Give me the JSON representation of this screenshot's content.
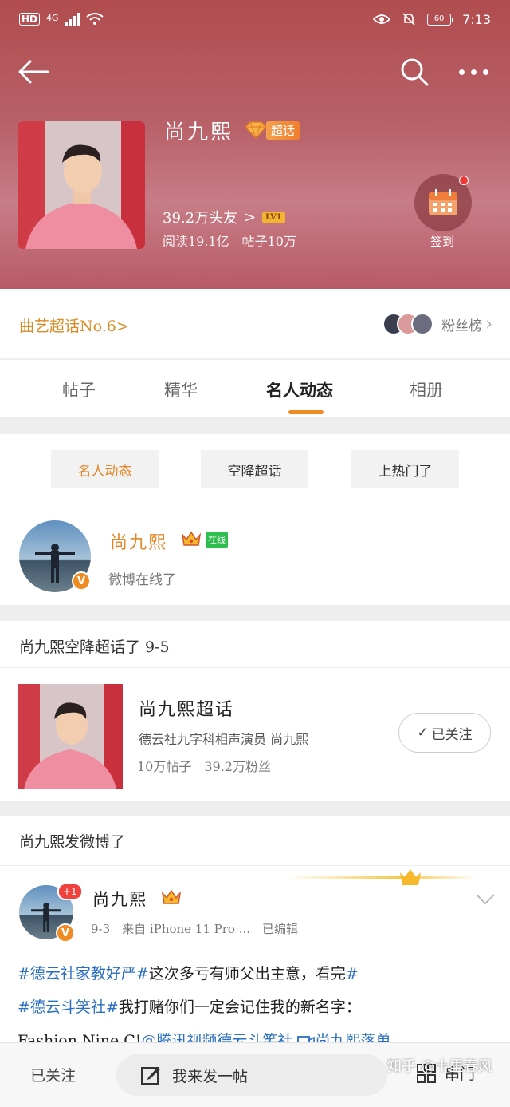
{
  "status_bar": {
    "hd": "HD",
    "network": "4G",
    "battery": "60",
    "time": "7:13"
  },
  "hero": {
    "title": "尚九熙",
    "super_tag": "超话",
    "fans": "39.2万头友",
    "fans_arrow": ">",
    "level": "LV1",
    "stats": "阅读19.1亿　帖子10万",
    "checkin_label": "签到"
  },
  "rank": {
    "left": "曲艺超话No.6>",
    "right": "粉丝榜",
    "right_arrow": "›"
  },
  "tabs": [
    "帖子",
    "精华",
    "名人动态",
    "相册"
  ],
  "subtabs": [
    "名人动态",
    "空降超话",
    "上热门了"
  ],
  "online_card": {
    "name": "尚九熙",
    "status_tag": "在线",
    "text": "微博在线了",
    "v_badge": "V"
  },
  "section_super": {
    "title": "尚九熙空降超话了 9-5"
  },
  "super_card": {
    "name": "尚九熙超话",
    "desc": "德云社九字科相声演员 尚九熙",
    "stats": "10万帖子　39.2万粉丝",
    "follow_label": "已关注",
    "check": "✓"
  },
  "section_weibo": {
    "title": "尚九熙发微博了"
  },
  "post": {
    "badge": "+1",
    "name": "尚九熙",
    "meta": "9-3　来自 iPhone 11 Pro ...　已编辑",
    "line1_tag1": "#德云社家教好严#",
    "line1_text": "这次多亏有师父出主意，看完",
    "line2_tag": "#德云斗笑社#",
    "line2_text": "我打赌你们一定会记住我的新名字：",
    "line3_text": "Fashion Nine C!",
    "line3_mention": "@腾讯视频德云斗笑社",
    "line3_link": "尚九熙落单"
  },
  "bottom": {
    "follow": "已关注",
    "post_button": "我来发一帖",
    "right": "串门"
  },
  "watermark": "知乎 @十里春风",
  "colors": {
    "accent": "#f08a22",
    "link": "#2b6fc2",
    "hero": "#b04c4e"
  }
}
